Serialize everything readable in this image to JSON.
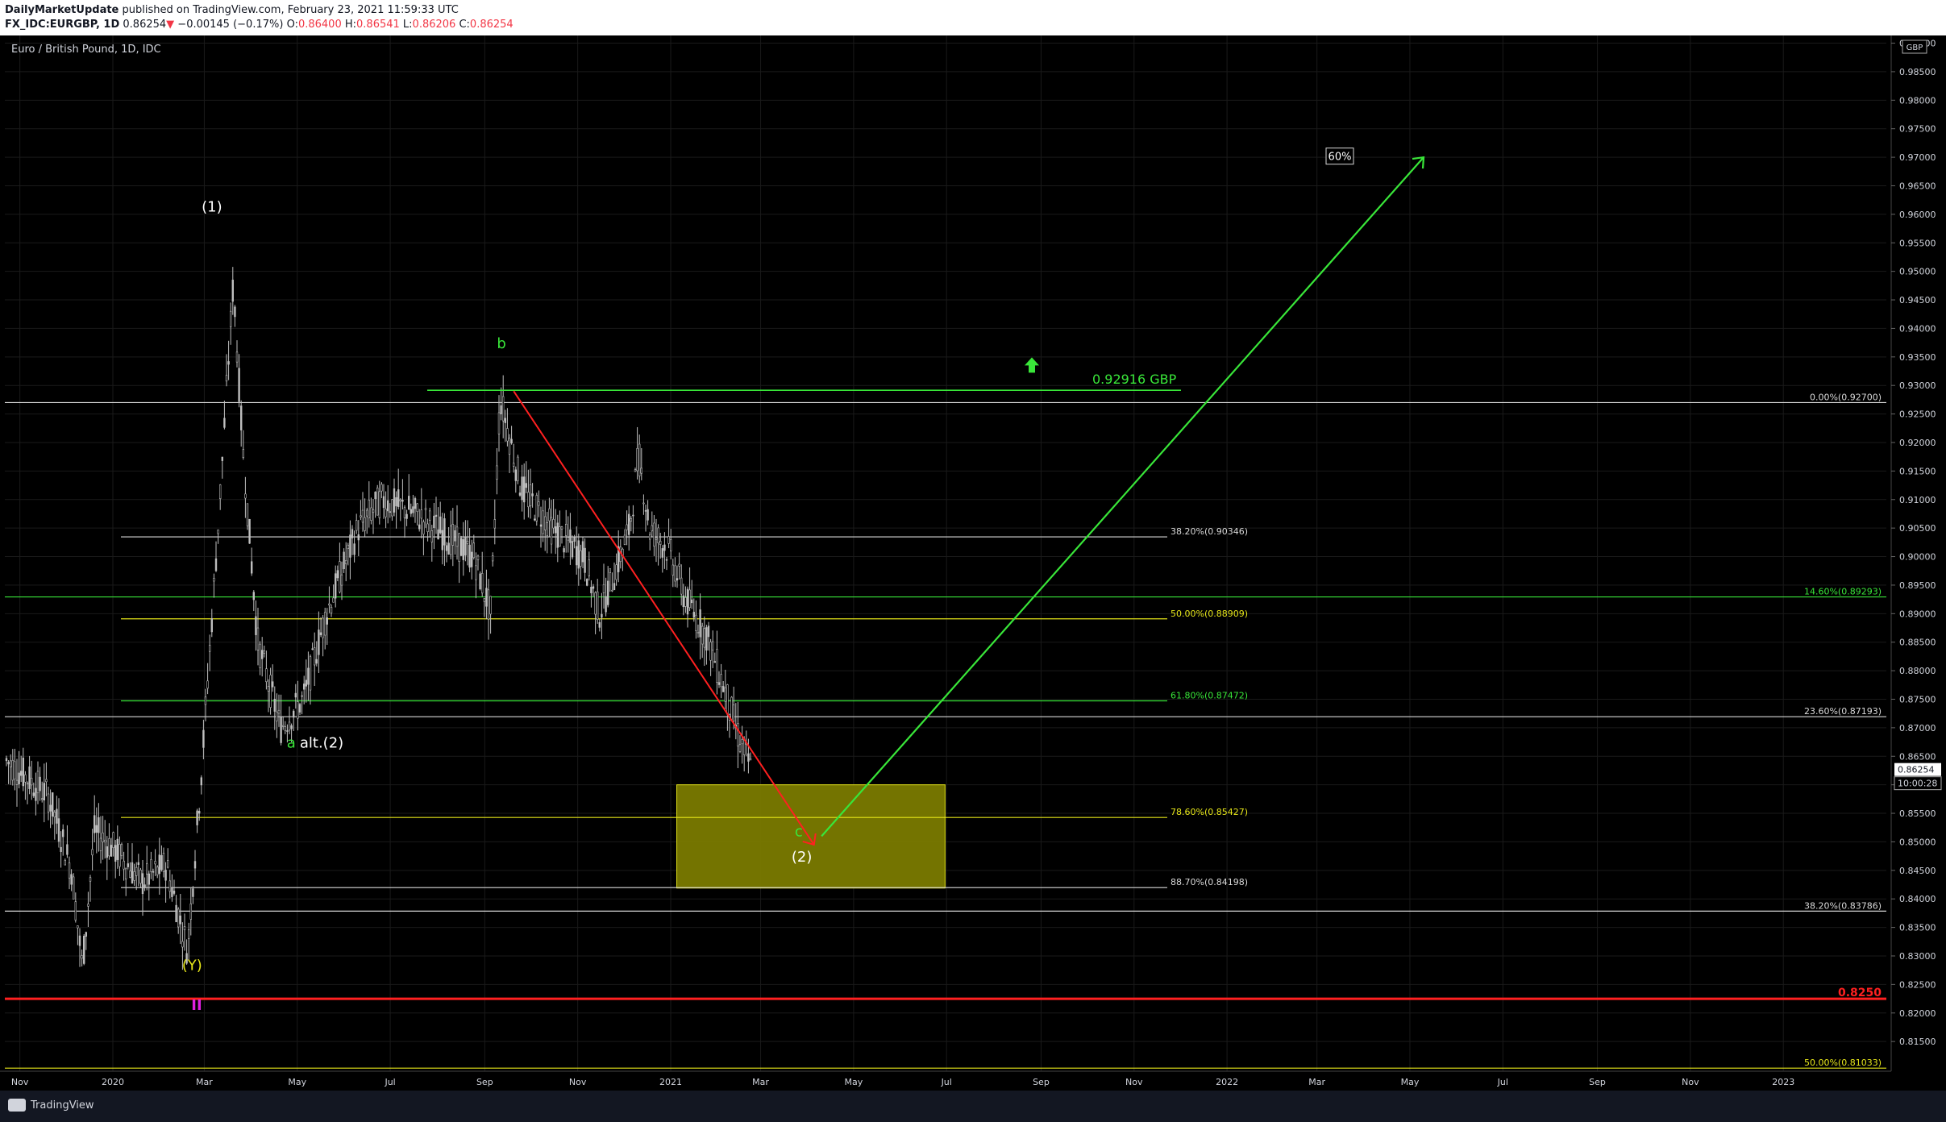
{
  "header": {
    "author": "DailyMarketUpdate",
    "published_text": "published on TradingView.com, February 23, 2021 11:59:33 UTC",
    "symbol": "FX_IDC:EURGBP, 1D",
    "last": "0.86254",
    "change": "−0.00145 (−0.17%)",
    "o_label": "O:",
    "o": "0.86400",
    "h_label": "H:",
    "h": "0.86541",
    "l_label": "L:",
    "l": "0.86206",
    "c_label": "C:",
    "c": "0.86254"
  },
  "chart_title": "Euro / British Pound, 1D, IDC",
  "footer": {
    "brand": "TradingView"
  },
  "colors": {
    "background": "#000000",
    "candle": "#bfbfbf",
    "grid": "#1a1a1a",
    "green": "#39e639",
    "red": "#ff2020",
    "yellow": "#e6e619",
    "white": "#d9d9d9",
    "box_fill": "#7a7a00",
    "magenta": "#e020e0"
  },
  "chart_data": {
    "type": "candlestick",
    "symbol": "EURGBP",
    "currency": "GBP",
    "x_tick_labels": [
      "Nov",
      "2020",
      "Mar",
      "May",
      "Jul",
      "Sep",
      "Nov",
      "2021",
      "Mar",
      "May",
      "Jul",
      "Sep",
      "Nov",
      "2022",
      "Mar",
      "May",
      "Jul",
      "Sep",
      "Nov",
      "2023"
    ],
    "y_tick_labels": [
      "0.81500",
      "0.82000",
      "0.82500",
      "0.83000",
      "0.83500",
      "0.84000",
      "0.84500",
      "0.85000",
      "0.85500",
      "0.86000",
      "0.86500",
      "0.87000",
      "0.87500",
      "0.88000",
      "0.88500",
      "0.89000",
      "0.89500",
      "0.90000",
      "0.90500",
      "0.91000",
      "0.91500",
      "0.92000",
      "0.92500",
      "0.93000",
      "0.93500",
      "0.94000",
      "0.94500",
      "0.95000",
      "0.95500",
      "0.96000",
      "0.96500",
      "0.97000",
      "0.97500",
      "0.98000",
      "0.98500",
      "0.99000"
    ],
    "ylim": [
      0.8105,
      0.9905
    ],
    "last_price": "0.86254",
    "countdown": "10:00:28",
    "price_path": [
      [
        "2019-10-20",
        0.865
      ],
      [
        "2019-11-20",
        0.858
      ],
      [
        "2019-12-05",
        0.845
      ],
      [
        "2019-12-12",
        0.828
      ],
      [
        "2019-12-20",
        0.852
      ],
      [
        "2020-01-01",
        0.849
      ],
      [
        "2020-01-20",
        0.843
      ],
      [
        "2020-02-05",
        0.846
      ],
      [
        "2020-02-19",
        0.831
      ],
      [
        "2020-02-28",
        0.862
      ],
      [
        "2020-03-10",
        0.905
      ],
      [
        "2020-03-20",
        0.948
      ],
      [
        "2020-03-26",
        0.92
      ],
      [
        "2020-04-05",
        0.885
      ],
      [
        "2020-04-20",
        0.87
      ],
      [
        "2020-05-05",
        0.875
      ],
      [
        "2020-05-20",
        0.89
      ],
      [
        "2020-06-10",
        0.905
      ],
      [
        "2020-06-25",
        0.91
      ],
      [
        "2020-07-15",
        0.908
      ],
      [
        "2020-08-05",
        0.904
      ],
      [
        "2020-08-25",
        0.9
      ],
      [
        "2020-09-05",
        0.89
      ],
      [
        "2020-09-11",
        0.928
      ],
      [
        "2020-09-25",
        0.912
      ],
      [
        "2020-10-15",
        0.905
      ],
      [
        "2020-11-05",
        0.9
      ],
      [
        "2020-11-15",
        0.89
      ],
      [
        "2020-11-25",
        0.897
      ],
      [
        "2020-12-05",
        0.905
      ],
      [
        "2020-12-11",
        0.918
      ],
      [
        "2020-12-18",
        0.905
      ],
      [
        "2020-12-31",
        0.901
      ],
      [
        "2021-01-10",
        0.893
      ],
      [
        "2021-01-25",
        0.886
      ],
      [
        "2021-02-05",
        0.877
      ],
      [
        "2021-02-15",
        0.868
      ],
      [
        "2021-02-23",
        0.86254
      ]
    ],
    "fib_levels": [
      {
        "label": "0.00%(0.92700)",
        "value": 0.927,
        "color": "white"
      },
      {
        "label": "38.20%(0.90346)",
        "value": 0.90346,
        "color": "white"
      },
      {
        "label": "14.60%(0.89293)",
        "value": 0.89293,
        "color": "green"
      },
      {
        "label": "50.00%(0.88909)",
        "value": 0.88909,
        "color": "yellow"
      },
      {
        "label": "61.80%(0.87472)",
        "value": 0.87472,
        "color": "green"
      },
      {
        "label": "23.60%(0.87193)",
        "value": 0.87193,
        "color": "white"
      },
      {
        "label": "78.60%(0.85427)",
        "value": 0.85427,
        "color": "yellow"
      },
      {
        "label": "88.70%(0.84198)",
        "value": 0.84198,
        "color": "white"
      },
      {
        "label": "38.20%(0.83786)",
        "value": 0.83786,
        "color": "white"
      },
      {
        "label": "0.8250",
        "value": 0.8225,
        "color": "red"
      },
      {
        "label": "50.00%(0.81033)",
        "value": 0.81033,
        "color": "yellow"
      }
    ],
    "target": {
      "label": "0.92916 GBP",
      "value": 0.92916
    },
    "wave_labels": [
      "(1)",
      "b",
      "a",
      "alt.(2)",
      "c",
      "(2)",
      "(Y)",
      "II"
    ],
    "percent_label": "60%",
    "projection": {
      "from": [
        "2021-04-10",
        0.851
      ],
      "to": [
        "2022-05-10",
        0.97
      ]
    },
    "decline": {
      "from": [
        "2020-09-20",
        0.929
      ],
      "to": [
        "2021-04-05",
        0.8495
      ]
    },
    "zone": {
      "from": "2021-01-05",
      "to": "2021-06-30",
      "top": 0.86,
      "bottom": 0.8419
    }
  }
}
